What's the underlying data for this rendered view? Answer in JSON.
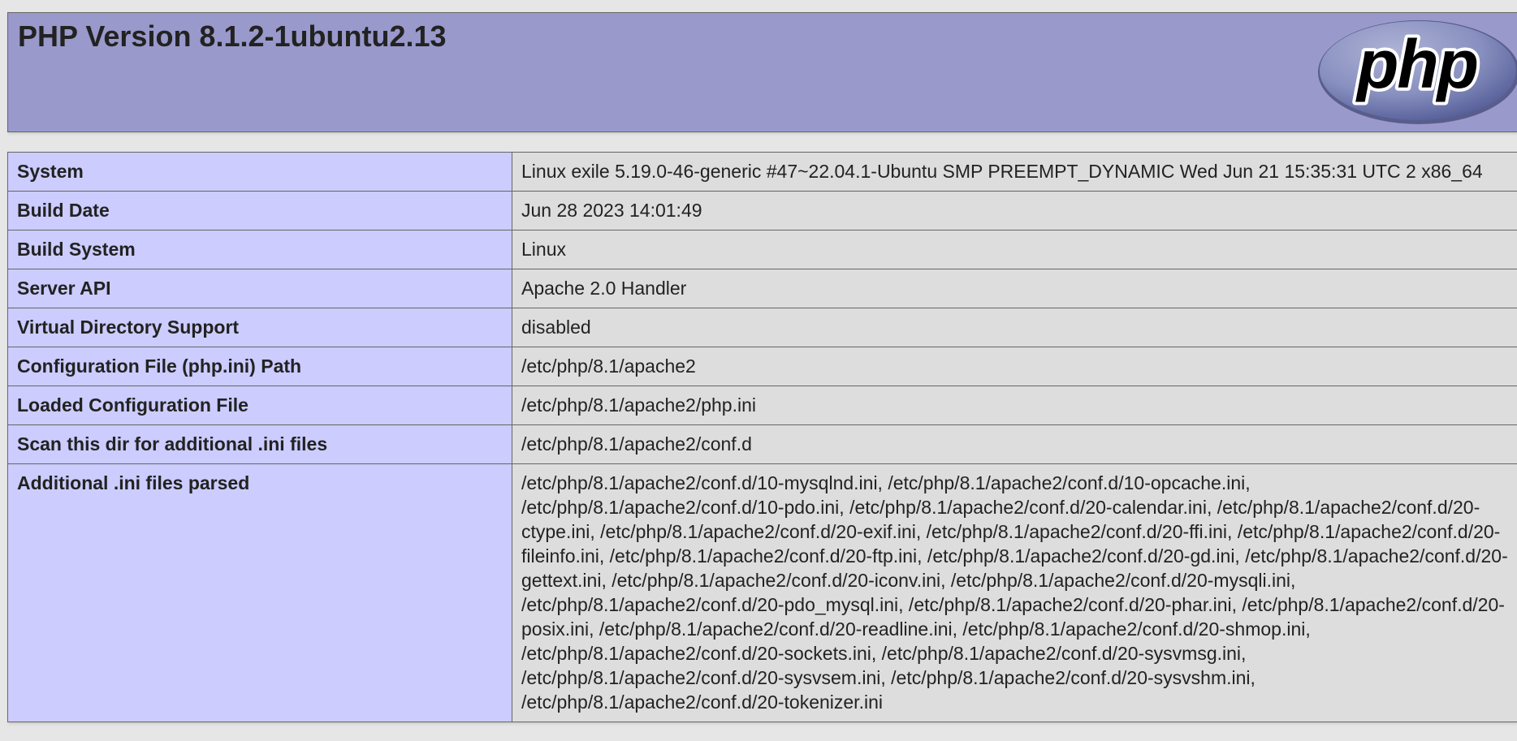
{
  "header": {
    "title": "PHP Version 8.1.2-1ubuntu2.13",
    "logo_text": "php"
  },
  "colors": {
    "header_bg": "#9999cc",
    "label_bg": "#ccccff",
    "value_bg": "#dddddd",
    "page_bg": "#e6e6e6"
  },
  "rows": [
    {
      "label": "System",
      "value": "Linux exile 5.19.0-46-generic #47~22.04.1-Ubuntu SMP PREEMPT_DYNAMIC Wed Jun 21 15:35:31 UTC 2 x86_64"
    },
    {
      "label": "Build Date",
      "value": "Jun 28 2023 14:01:49"
    },
    {
      "label": "Build System",
      "value": "Linux"
    },
    {
      "label": "Server API",
      "value": "Apache 2.0 Handler"
    },
    {
      "label": "Virtual Directory Support",
      "value": "disabled"
    },
    {
      "label": "Configuration File (php.ini) Path",
      "value": "/etc/php/8.1/apache2"
    },
    {
      "label": "Loaded Configuration File",
      "value": "/etc/php/8.1/apache2/php.ini"
    },
    {
      "label": "Scan this dir for additional .ini files",
      "value": "/etc/php/8.1/apache2/conf.d"
    },
    {
      "label": "Additional .ini files parsed",
      "value": "/etc/php/8.1/apache2/conf.d/10-mysqlnd.ini, /etc/php/8.1/apache2/conf.d/10-opcache.ini, /etc/php/8.1/apache2/conf.d/10-pdo.ini, /etc/php/8.1/apache2/conf.d/20-calendar.ini, /etc/php/8.1/apache2/conf.d/20-ctype.ini, /etc/php/8.1/apache2/conf.d/20-exif.ini, /etc/php/8.1/apache2/conf.d/20-ffi.ini, /etc/php/8.1/apache2/conf.d/20-fileinfo.ini, /etc/php/8.1/apache2/conf.d/20-ftp.ini, /etc/php/8.1/apache2/conf.d/20-gd.ini, /etc/php/8.1/apache2/conf.d/20-gettext.ini, /etc/php/8.1/apache2/conf.d/20-iconv.ini, /etc/php/8.1/apache2/conf.d/20-mysqli.ini, /etc/php/8.1/apache2/conf.d/20-pdo_mysql.ini, /etc/php/8.1/apache2/conf.d/20-phar.ini, /etc/php/8.1/apache2/conf.d/20-posix.ini, /etc/php/8.1/apache2/conf.d/20-readline.ini, /etc/php/8.1/apache2/conf.d/20-shmop.ini, /etc/php/8.1/apache2/conf.d/20-sockets.ini, /etc/php/8.1/apache2/conf.d/20-sysvmsg.ini, /etc/php/8.1/apache2/conf.d/20-sysvsem.ini, /etc/php/8.1/apache2/conf.d/20-sysvshm.ini, /etc/php/8.1/apache2/conf.d/20-tokenizer.ini"
    }
  ]
}
